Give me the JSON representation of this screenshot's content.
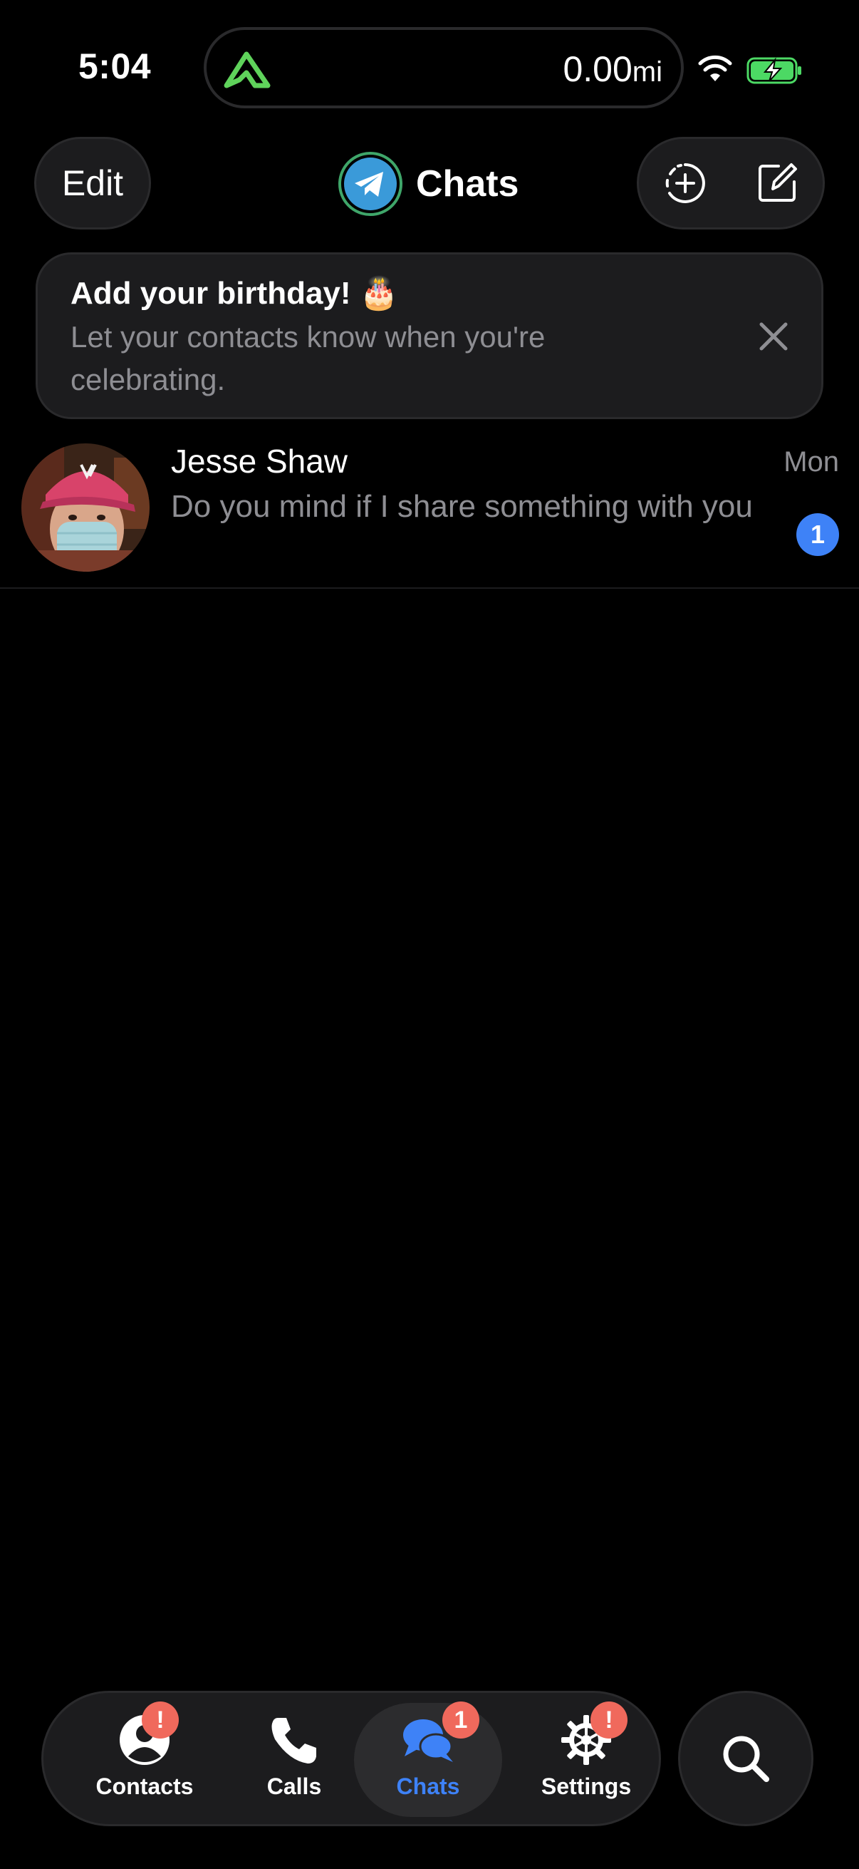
{
  "status_bar": {
    "time": "5:04",
    "activity_value": "0.00",
    "activity_unit": "mi"
  },
  "header": {
    "edit_label": "Edit",
    "title": "Chats"
  },
  "birthday_banner": {
    "title": "Add your birthday! 🎂",
    "subtitle": "Let your contacts know when you're celebrating."
  },
  "chats": [
    {
      "name": "Jesse Shaw",
      "time": "Mon",
      "preview": "Do you mind if I share something with you",
      "unread": "1"
    }
  ],
  "tabs": [
    {
      "label": "Contacts",
      "badge": "!"
    },
    {
      "label": "Calls",
      "badge": ""
    },
    {
      "label": "Chats",
      "badge": "1"
    },
    {
      "label": "Settings",
      "badge": "!"
    }
  ],
  "colors": {
    "accent": "#3e82f7",
    "badge": "#f0695c",
    "activity_green": "#5fd35b",
    "battery_green": "#4cd964"
  }
}
